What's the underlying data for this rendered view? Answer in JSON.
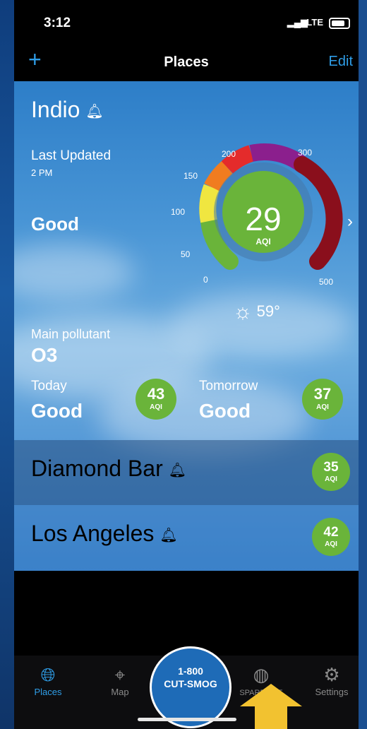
{
  "status": {
    "time": "3:12",
    "network": "LTE"
  },
  "nav": {
    "title": "Places",
    "edit": "Edit",
    "add_icon": "plus-icon"
  },
  "main": {
    "city": "Indio",
    "last_updated_label": "Last Updated",
    "last_updated_time": "2 PM",
    "status_text": "Good",
    "aqi": "29",
    "aqi_unit": "AQI",
    "gauge_ticks": [
      "0",
      "50",
      "100",
      "150",
      "200",
      "300",
      "500"
    ],
    "temperature": "59°",
    "main_pollutant_label": "Main pollutant",
    "main_pollutant": "O3",
    "today_label": "Today",
    "today_status": "Good",
    "today_aqi": "43",
    "tomorrow_label": "Tomorrow",
    "tomorrow_status": "Good",
    "tomorrow_aqi": "37",
    "aqi_small_unit": "AQI"
  },
  "places": [
    {
      "city": "Diamond Bar",
      "aqi": "35",
      "unit": "AQI"
    },
    {
      "city": "Los Angeles",
      "aqi": "42",
      "unit": "AQI"
    }
  ],
  "tabs": [
    {
      "label": "Places",
      "icon": "globe-pin-icon",
      "active": true
    },
    {
      "label": "Map",
      "icon": "map-pin-icon",
      "active": false
    },
    {
      "label": "SPARE THE AIR",
      "icon": "leaf-icon",
      "active": false
    },
    {
      "label": "Settings",
      "icon": "gear-icon",
      "active": false
    }
  ],
  "cta": {
    "line1": "1-800",
    "line2": "CUT-SMOG"
  },
  "colors": {
    "accent": "#2f9ee8",
    "good": "#6ab43a",
    "sky": "#4a96d6"
  }
}
